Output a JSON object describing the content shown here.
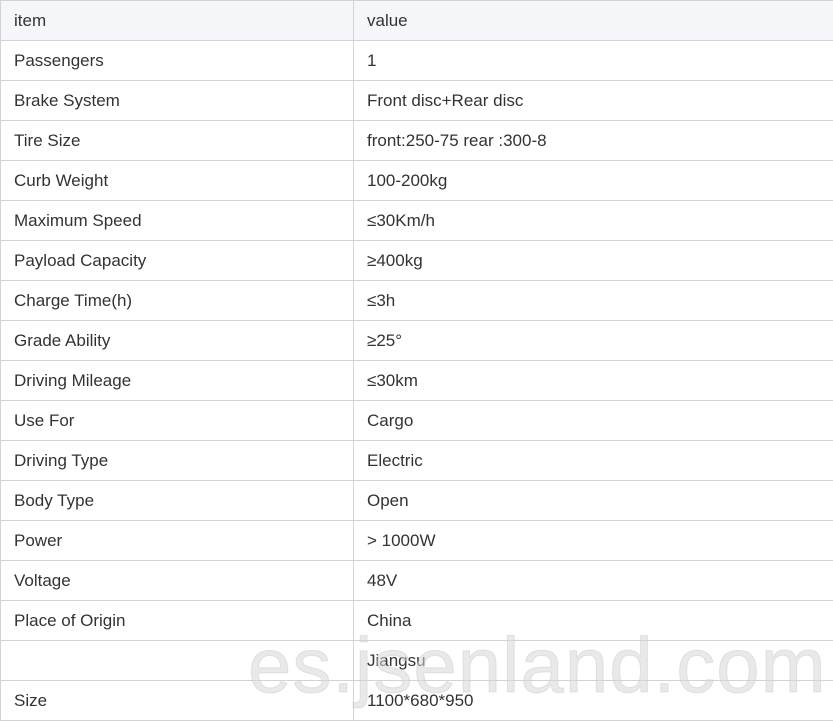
{
  "table": {
    "headers": [
      "item",
      "value"
    ],
    "rows": [
      {
        "item": "Passengers",
        "value": "1"
      },
      {
        "item": "Brake System",
        "value": "Front disc+Rear disc"
      },
      {
        "item": "Tire Size",
        "value": "front:250-75 rear :300-8"
      },
      {
        "item": "Curb Weight",
        "value": "100-200kg"
      },
      {
        "item": "Maximum Speed",
        "value": "≤30Km/h"
      },
      {
        "item": "Payload Capacity",
        "value": "≥400kg"
      },
      {
        "item": "Charge Time(h)",
        "value": "≤3h"
      },
      {
        "item": "Grade Ability",
        "value": "≥25°"
      },
      {
        "item": "Driving Mileage",
        "value": "≤30km"
      },
      {
        "item": "Use For",
        "value": "Cargo"
      },
      {
        "item": "Driving Type",
        "value": "Electric"
      },
      {
        "item": "Body Type",
        "value": "Open"
      },
      {
        "item": "Power",
        "value": "> 1000W"
      },
      {
        "item": "Voltage",
        "value": "48V"
      },
      {
        "item": "Place of Origin",
        "value": "China"
      },
      {
        "item": "",
        "value": "Jiangsu"
      },
      {
        "item": "Size",
        "value": "1100*680*950"
      }
    ]
  },
  "watermark": "es.jsenland.com",
  "colors": {
    "header_bg": "#f5f7fa",
    "border": "#d3d3d3",
    "text": "#333333"
  }
}
